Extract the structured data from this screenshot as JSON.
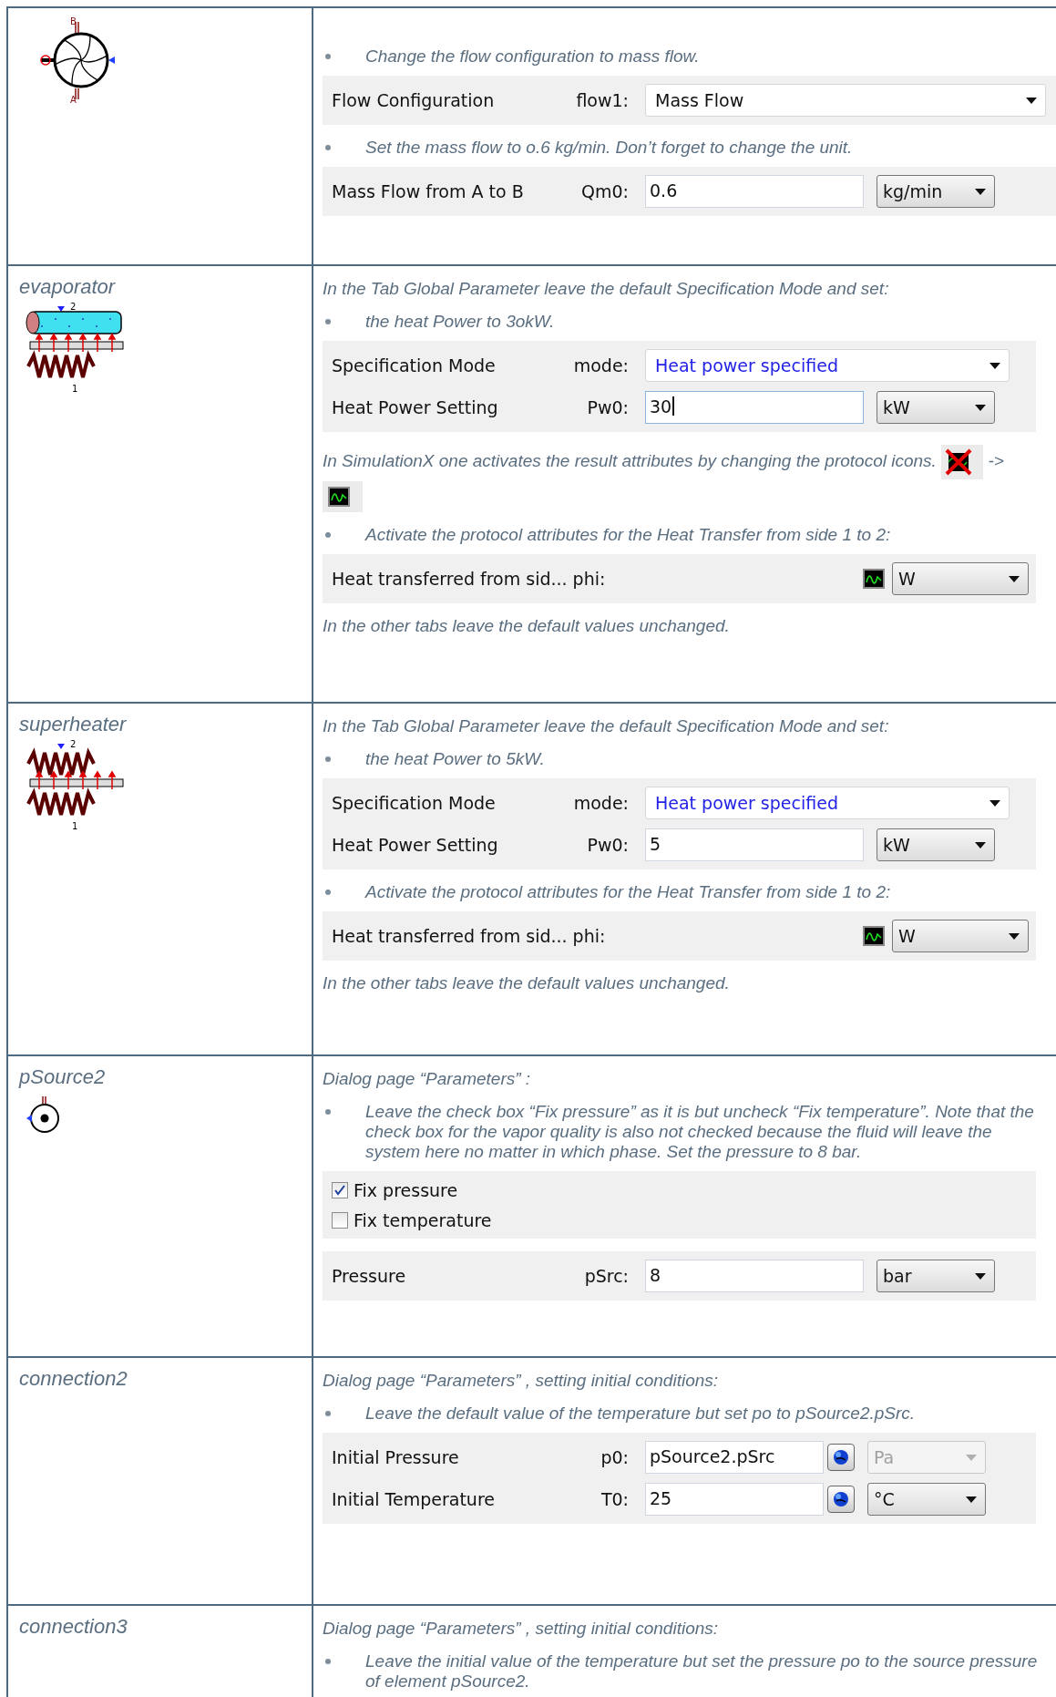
{
  "rows": [
    {
      "kind": "fan",
      "ports": [
        "B",
        "A"
      ],
      "blocks": [
        {
          "kind": "bullet",
          "text": "Change the flow configuration to mass flow."
        },
        {
          "kind": "panel",
          "fields": [
            {
              "kind": "select",
              "label": "Flow Configuration",
              "param": "flow1:",
              "value": "Mass Flow",
              "modified": false
            }
          ]
        },
        {
          "kind": "bullet",
          "text": "Set the mass flow to o.6 kg/min. Don’t forget to change the unit."
        },
        {
          "kind": "panel",
          "fields": [
            {
              "kind": "input",
              "label": "Mass Flow from A to B",
              "param": "Qm0:",
              "value": "0.6",
              "unit": "kg/min",
              "unit_disabled": false,
              "editing": false,
              "formula": false
            }
          ]
        }
      ]
    },
    {
      "name": "evaporator",
      "kind": "evaporator",
      "ports": [
        "2",
        "1"
      ],
      "blocks": [
        {
          "kind": "text",
          "text": "In the Tab Global Parameter leave the default Specification Mode and set:"
        },
        {
          "kind": "bullet",
          "text": "the heat Power to 3okW."
        },
        {
          "kind": "panel",
          "fields": [
            {
              "kind": "select",
              "label": "Specification Mode",
              "param": "mode:",
              "value": "Heat power specified",
              "modified": true
            },
            {
              "kind": "input",
              "label": "Heat Power Setting",
              "param": "Pw0:",
              "value": "30",
              "unit": "kW",
              "unit_disabled": false,
              "editing": true,
              "formula": false
            }
          ]
        },
        {
          "kind": "note",
          "text": "In SimulationX one activates the result attributes by changing the protocol icons.",
          "arrow": "->"
        },
        {
          "kind": "bullet",
          "text": "Activate the protocol attributes for the Heat Transfer from side 1 to 2:"
        },
        {
          "kind": "panel",
          "fields": [
            {
              "kind": "protocol",
              "label": "Heat transferred from sid...",
              "param": "phi:",
              "unit": "W",
              "protocol": true
            }
          ]
        },
        {
          "kind": "text",
          "text": "In the other tabs leave the default values unchanged."
        }
      ]
    },
    {
      "name": "superheater",
      "kind": "exchanger",
      "ports": [
        "2",
        "1"
      ],
      "blocks": [
        {
          "kind": "text",
          "text": "In the Tab Global Parameter leave the default Specification Mode and set:"
        },
        {
          "kind": "bullet",
          "text": "the heat Power to 5kW."
        },
        {
          "kind": "panel",
          "fields": [
            {
              "kind": "select",
              "label": "Specification Mode",
              "param": "mode:",
              "value": "Heat power specified",
              "modified": true
            },
            {
              "kind": "input",
              "label": "Heat Power Setting",
              "param": "Pw0:",
              "value": "5",
              "unit": "kW",
              "unit_disabled": false,
              "editing": false,
              "formula": false
            }
          ]
        },
        {
          "kind": "bullet",
          "text": "Activate the protocol attributes for the Heat Transfer from side 1 to 2:"
        },
        {
          "kind": "panel",
          "fields": [
            {
              "kind": "protocol",
              "label": "Heat transferred from sid...",
              "param": "phi:",
              "unit": "W",
              "protocol": true
            }
          ]
        },
        {
          "kind": "text",
          "text": "In the other tabs leave the default values unchanged."
        }
      ]
    },
    {
      "name": "pSource2",
      "kind": "source",
      "blocks": [
        {
          "kind": "text",
          "text": "Dialog page “Parameters” :"
        },
        {
          "kind": "bullet",
          "text": "Leave the check box “Fix pressure” as it is but uncheck “Fix temperature”. Note that the check box for the vapor quality is also not checked because the fluid will leave the system here no matter in which phase. Set the pressure to 8 bar."
        },
        {
          "kind": "panel",
          "fields": [
            {
              "kind": "check",
              "label": "Fix pressure",
              "checked": true
            },
            {
              "kind": "check",
              "label": "Fix temperature",
              "checked": false
            }
          ]
        },
        {
          "kind": "panel",
          "fields": [
            {
              "kind": "input",
              "label": "Pressure",
              "param": "pSrc:",
              "value": "8",
              "unit": "bar",
              "unit_disabled": false,
              "editing": false,
              "formula": false
            }
          ]
        }
      ]
    },
    {
      "name": "connection2",
      "blocks": [
        {
          "kind": "text",
          "text": "Dialog page “Parameters” , setting initial conditions:"
        },
        {
          "kind": "bullet",
          "text": "Leave the default value of the temperature but set po to pSource2.pSrc."
        },
        {
          "kind": "panel",
          "fields": [
            {
              "kind": "input",
              "label": "Initial Pressure",
              "param": "p0:",
              "value": "pSource2.pSrc",
              "unit": "Pa",
              "unit_disabled": true,
              "editing": false,
              "formula": true
            },
            {
              "kind": "input",
              "label": "Initial Temperature",
              "param": "T0:",
              "value": "25",
              "unit": "°C",
              "unit_disabled": false,
              "editing": false,
              "formula": true
            }
          ]
        }
      ]
    },
    {
      "name": "connection3",
      "blocks": [
        {
          "kind": "text",
          "text": "Dialog page “Parameters” , setting initial conditions:"
        },
        {
          "kind": "bullet",
          "text": "Leave the initial value of the temperature but set the pressure po to the source pressure of element pSource2."
        }
      ]
    }
  ]
}
